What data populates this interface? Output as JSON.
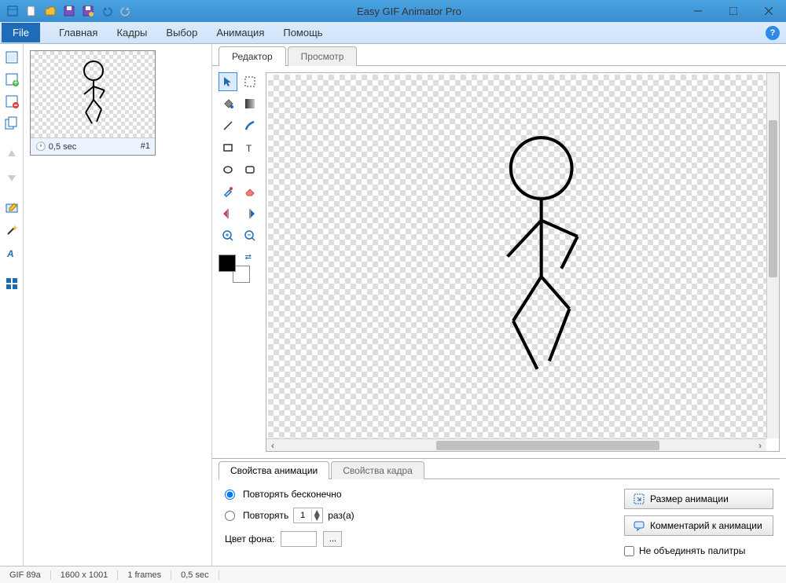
{
  "app": {
    "title": "Easy GIF Animator Pro"
  },
  "menu": {
    "file": "File",
    "items": [
      "Главная",
      "Кадры",
      "Выбор",
      "Анимация",
      "Помощь"
    ]
  },
  "editor_tabs": {
    "editor": "Редактор",
    "preview": "Просмотр"
  },
  "frame": {
    "duration": "0,5 sec",
    "index": "#1"
  },
  "property_tabs": {
    "anim": "Свойства анимации",
    "frame": "Свойства кадра"
  },
  "properties": {
    "repeat_infinite": "Повторять бесконечно",
    "repeat_label": "Повторять",
    "repeat_count": "1",
    "repeat_unit": "раз(а)",
    "bg_color_label": "Цвет фона:",
    "browse": "...",
    "size_btn": "Размер анимации",
    "comment_btn": "Комментарий к анимации",
    "no_merge_palettes": "Не объединять палитры"
  },
  "status": {
    "format": "GIF 89a",
    "dimensions": "1600 x 1001",
    "frames": "1 frames",
    "duration": "0,5 sec"
  }
}
